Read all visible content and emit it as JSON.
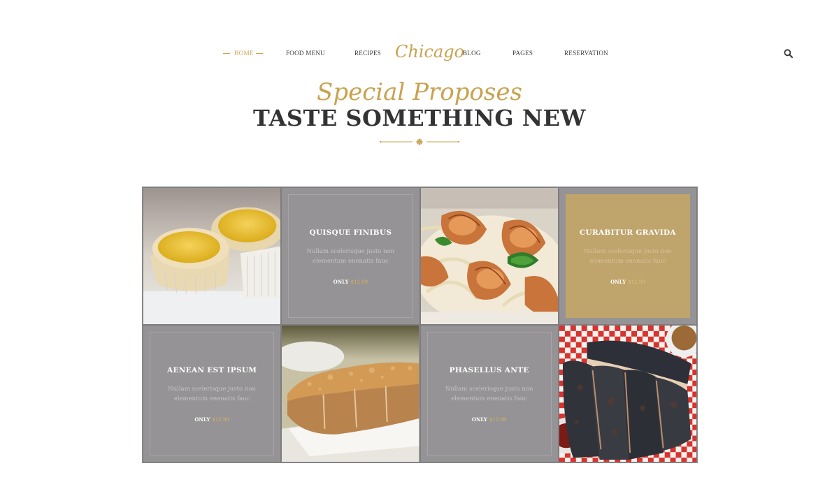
{
  "nav": {
    "left_items": [
      {
        "label": "HOME",
        "active": true
      },
      {
        "label": "FOOD MENU"
      },
      {
        "label": "RECIPES"
      }
    ],
    "logo": "Chicago",
    "right_items": [
      {
        "label": "BLOG"
      },
      {
        "label": "PAGES"
      },
      {
        "label": "RESERVATION"
      }
    ],
    "search_icon": "search-icon"
  },
  "heading": {
    "script": "Special Proposes",
    "title": "TASTE SOMETHING NEW"
  },
  "cards": [
    {
      "title": "QUISQUE FINIBUS",
      "desc_line1": "Nullam scelerisque justo non",
      "desc_line2": "elementum enenatis fauc",
      "price_label": "ONLY",
      "price": "$12.99"
    },
    {
      "title": "CURABITUR GRAVIDA",
      "desc_line1": "Nullam scelerisque justo non",
      "desc_line2": "elementum enenatis fauc",
      "price_label": "ONLY",
      "price": "$12.99"
    },
    {
      "title": "AENEAN EST IPSUM",
      "desc_line1": "Nullam scelerisque justo non",
      "desc_line2": "elementum enenatis fauc",
      "price_label": "ONLY",
      "price": "$12.99"
    },
    {
      "title": "PHASELLUS ANTE",
      "desc_line1": "Nullam scelerisque justo non",
      "desc_line2": "elementum enenatis fauc",
      "price_label": "ONLY",
      "price": "$12.99"
    }
  ],
  "colors": {
    "accent_gold": "#c9a24f",
    "card_gray": "#959395",
    "card_gold": "#bfa46c",
    "title_dark": "#333333"
  }
}
